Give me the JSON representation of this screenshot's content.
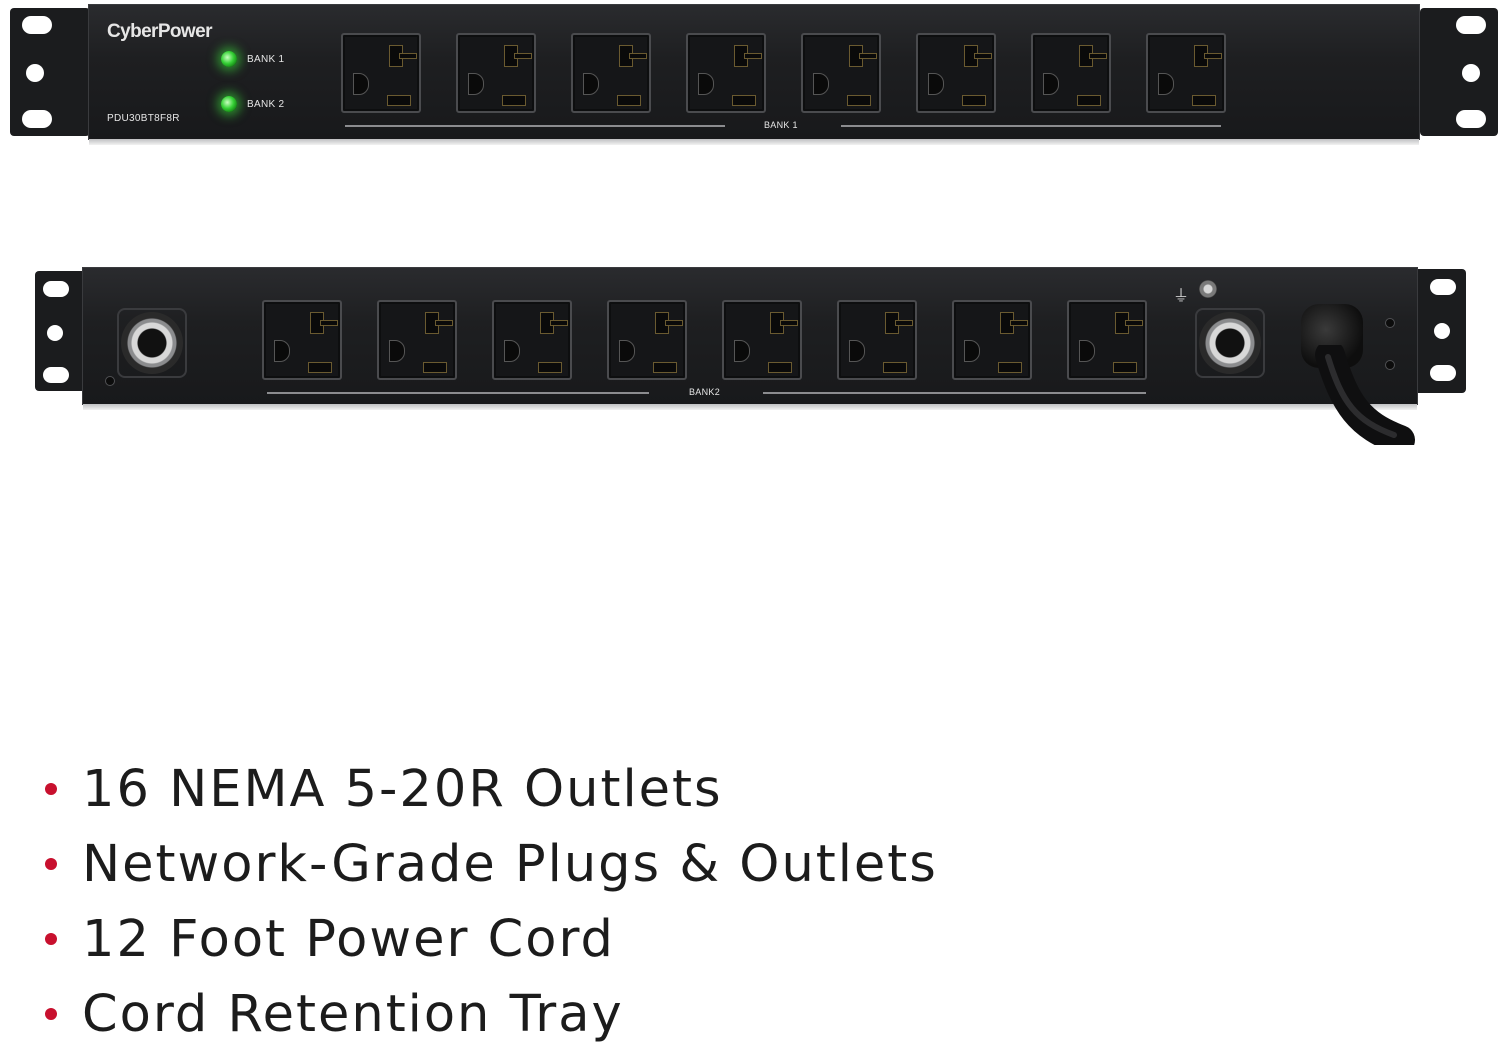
{
  "front_panel": {
    "brand": "CyberPower",
    "model": "PDU30BT8F8R",
    "led1_label": "BANK 1",
    "led2_label": "BANK 2",
    "outlet_group_label": "BANK 1",
    "outlet_count": 8
  },
  "rear_panel": {
    "outlet_group_label": "BANK2",
    "outlet_count": 8
  },
  "features": [
    "16 NEMA 5-20R Outlets",
    "Network-Grade Plugs & Outlets",
    "12 Foot Power Cord",
    "Cord Retention Tray"
  ],
  "colors": {
    "bullet": "#c8102e",
    "led": "#35d035",
    "chassis": "#1e1f21"
  }
}
